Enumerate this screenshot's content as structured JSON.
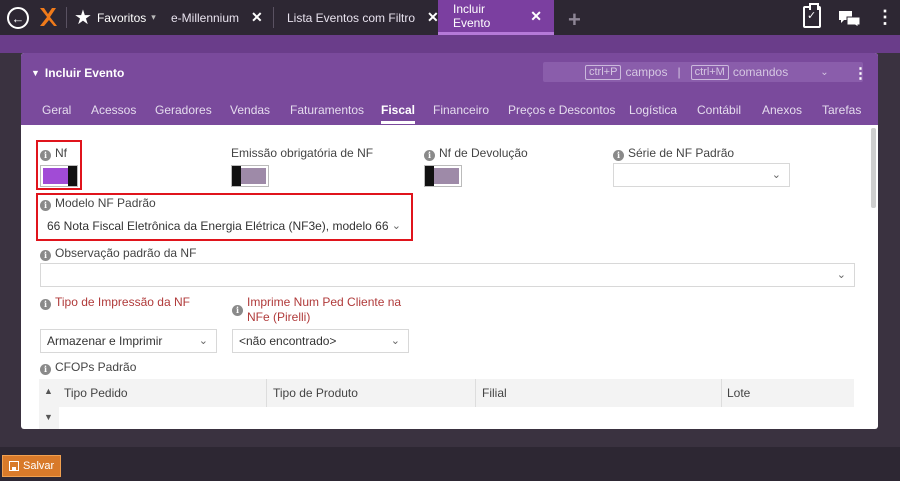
{
  "topbar": {
    "favorites_label": "Favoritos",
    "tabs": [
      {
        "label": "e-Millennium"
      },
      {
        "label": "Lista Eventos com Filtro"
      },
      {
        "label": "Incluir Evento"
      }
    ],
    "close_glyph": "✕",
    "plus_glyph": "+"
  },
  "panel": {
    "title": "Incluir Evento",
    "shortcuts": {
      "key1": "ctrl+P",
      "label1": "campos",
      "separator": "|",
      "key2": "ctrl+M",
      "label2": "comandos"
    },
    "tabs": [
      "Geral",
      "Acessos",
      "Geradores",
      "Vendas",
      "Faturamentos",
      "Fiscal",
      "Financeiro",
      "Preços e Descontos",
      "Logística",
      "Contábil",
      "Anexos",
      "Tarefas"
    ],
    "active_tab": "Fiscal"
  },
  "form": {
    "nf_label": "Nf",
    "emissao_label": "Emissão obrigatória de NF",
    "nf_devolucao_label": "Nf de Devolução",
    "serie_label": "Série de NF Padrão",
    "serie_value": "",
    "modelo_label": "Modelo NF Padrão",
    "modelo_value": "66 Nota Fiscal Eletrônica da Energia Elétrica (NF3e), modelo 66",
    "observacao_label": "Observação padrão da NF",
    "observacao_value": "",
    "tipo_impressao_label": "Tipo de Impressão da NF",
    "tipo_impressao_value": "Armazenar e Imprimir",
    "imprime_num_label_line1": "Imprime Num Ped Cliente na",
    "imprime_num_label_line2": "NFe (Pirelli)",
    "imprime_num_value": "<não encontrado>",
    "cfops_label": "CFOPs Padrão",
    "toggles": {
      "nf": true,
      "emissao": false,
      "nf_devolucao": false
    }
  },
  "grid": {
    "columns": [
      "Tipo Pedido",
      "Tipo de Produto",
      "Filial",
      "Lote"
    ]
  },
  "footer": {
    "save_label": "Salvar"
  },
  "colors": {
    "accent": "#7a4a9c",
    "toggle_on": "#a14bd6",
    "highlight": "#e0141c",
    "save": "#d87a2a"
  }
}
